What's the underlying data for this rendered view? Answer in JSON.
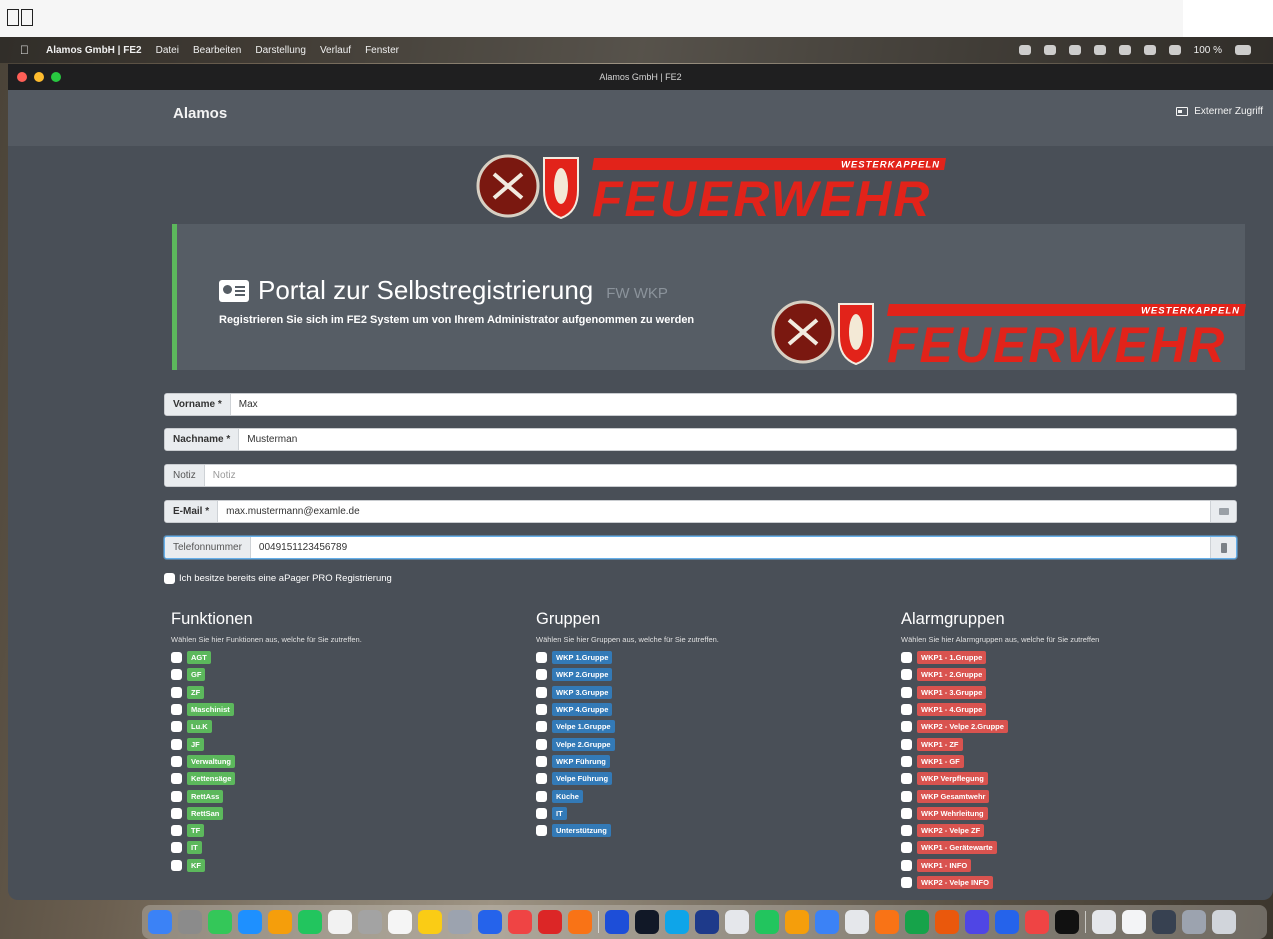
{
  "menubar": {
    "app": "Alamos GmbH | FE2",
    "items": [
      "Datei",
      "Bearbeiten",
      "Darstellung",
      "Verlauf",
      "Fenster"
    ],
    "battery": "100 %"
  },
  "window": {
    "title": "Alamos GmbH | FE2"
  },
  "nav": {
    "brand": "Alamos",
    "external_access": "Externer Zugriff"
  },
  "logo": {
    "ribbon": "WESTERKAPPELN",
    "word": "FEUERWEHR"
  },
  "hero": {
    "title": "Portal zur Selbstregistrierung",
    "title_small": "FW WKP",
    "subtitle": "Registrieren Sie sich im FE2 System um von Ihrem Administrator aufgenommen zu werden"
  },
  "form": {
    "first_name": {
      "label": "Vorname *",
      "value": "Max"
    },
    "last_name": {
      "label": "Nachname *",
      "value": "Musterman"
    },
    "note": {
      "label": "Notiz",
      "placeholder": "Notiz"
    },
    "email": {
      "label": "E-Mail *",
      "value": "max.mustermann@examle.de"
    },
    "phone": {
      "label": "Telefonnummer",
      "value": "0049151123456789"
    },
    "apager_label": "Ich besitze bereits eine aPager PRO Registrierung"
  },
  "functions": {
    "title": "Funktionen",
    "description": "Wählen Sie hier Funktionen aus, welche für Sie zutreffen.",
    "items": [
      "AGT",
      "GF",
      "ZF",
      "Maschinist",
      "Lu.K",
      "JF",
      "Verwaltung",
      "Kettensäge",
      "RettAss",
      "RettSan",
      "TF",
      "IT",
      "KF"
    ]
  },
  "groups": {
    "title": "Gruppen",
    "description": "Wählen Sie hier Gruppen aus, welche für Sie zutreffen.",
    "items": [
      "WKP 1.Gruppe",
      "WKP 2.Gruppe",
      "WKP 3.Gruppe",
      "WKP 4.Gruppe",
      "Velpe 1.Gruppe",
      "Velpe 2.Gruppe",
      "WKP Führung",
      "Velpe Führung",
      "Küche",
      "IT",
      "Unterstützung"
    ]
  },
  "alarm_groups": {
    "title": "Alarmgruppen",
    "description": "Wählen Sie hier Alarmgruppen aus, welche für Sie zutreffen",
    "items": [
      "WKP1 - 1.Gruppe",
      "WKP1 - 2.Gruppe",
      "WKP1 - 3.Gruppe",
      "WKP1 - 4.Gruppe",
      "WKP2 - Velpe 2.Gruppe",
      "WKP1 - ZF",
      "WKP1 - GF",
      "WKP Verpflegung",
      "WKP Gesamtwehr",
      "WKP Wehrleitung",
      "WKP2 - Velpe ZF",
      "WKP1 - Gerätewarte",
      "WKP1 - INFO",
      "WKP2 - Velpe INFO"
    ]
  },
  "colors": {
    "function_tag": "#5cb85c",
    "group_tag": "#337ab7",
    "alarm_tag": "#d9534f",
    "hero_accent": "#5cb85c",
    "logo_red": "#e2231a"
  }
}
